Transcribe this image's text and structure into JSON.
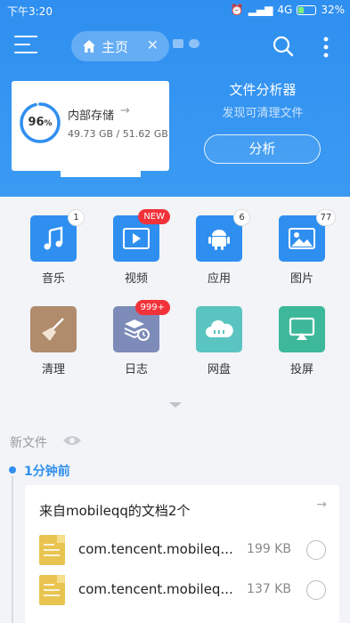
{
  "status_bar": {
    "time": "下午3:20",
    "network": "4G",
    "battery": "32%"
  },
  "header": {
    "tab_label": "主页"
  },
  "storage": {
    "percent_text": "96",
    "percent_sign": "%",
    "percent_value": 0.96,
    "title": "内部存储",
    "size": "49.73 GB / 51.62 GB"
  },
  "analyzer": {
    "title": "文件分析器",
    "subtitle": "发现可清理文件",
    "button": "分析"
  },
  "categories": [
    {
      "label": "音乐",
      "badge": "1",
      "color": "#2f8ff0",
      "icon": "music-note-icon"
    },
    {
      "label": "视频",
      "badge": "NEW",
      "color": "#2f8ff0",
      "icon": "video-icon"
    },
    {
      "label": "应用",
      "badge": "6",
      "color": "#2f8ff0",
      "icon": "android-icon"
    },
    {
      "label": "图片",
      "badge": "77",
      "color": "#2f8ff0",
      "icon": "image-icon"
    },
    {
      "label": "清理",
      "badge": "",
      "color": "#b08b6c",
      "icon": "broom-icon"
    },
    {
      "label": "日志",
      "badge": "999+",
      "color": "#7d8bb8",
      "icon": "log-icon"
    },
    {
      "label": "网盘",
      "badge": "",
      "color": "#5ac4c0",
      "icon": "cloud-icon"
    },
    {
      "label": "投屏",
      "badge": "",
      "color": "#3db89a",
      "icon": "cast-icon"
    }
  ],
  "recent": {
    "section_title": "新文件",
    "time_label": "1分钟前",
    "group_title": "来自mobileqq的文档2个",
    "files": [
      {
        "name": "com.tencent.mobileq...",
        "size": "199 KB"
      },
      {
        "name": "com.tencent.mobileq...",
        "size": "137 KB"
      }
    ]
  }
}
